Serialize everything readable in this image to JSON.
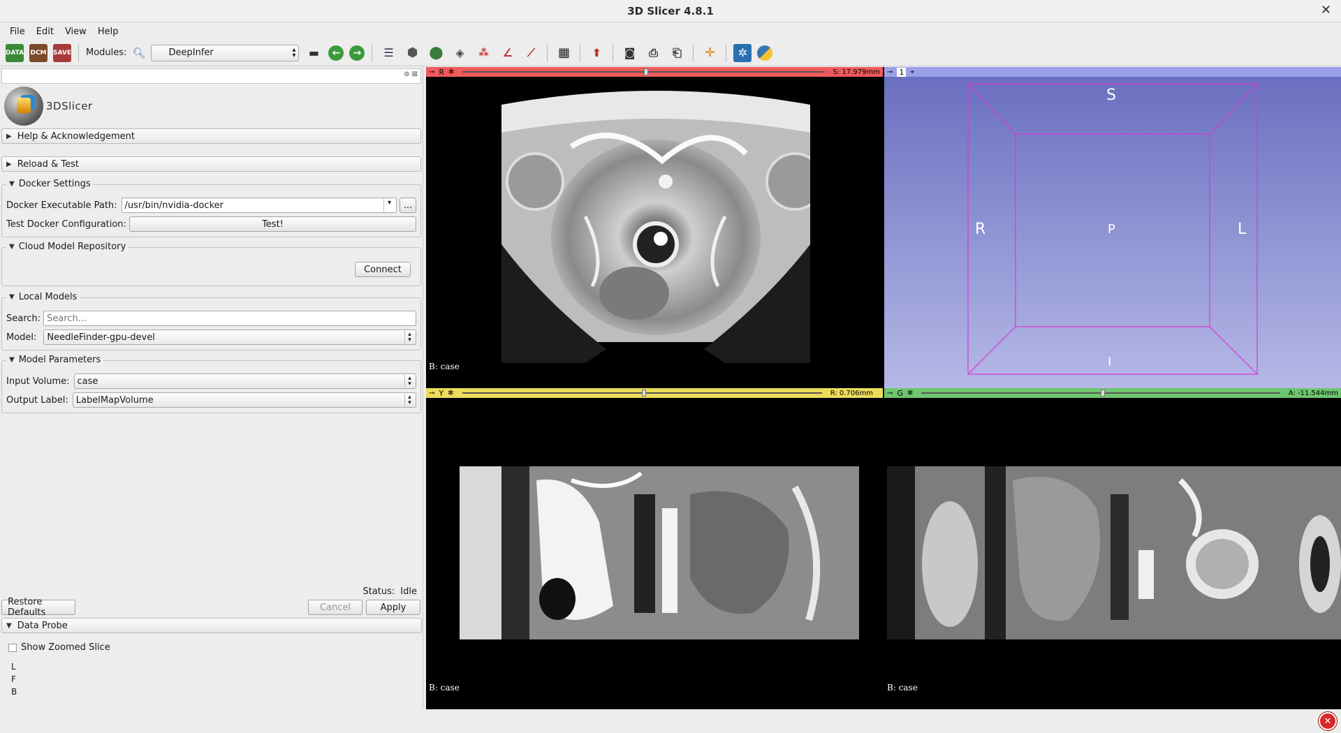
{
  "window": {
    "title": "3D Slicer 4.8.1",
    "close_glyph": "✕"
  },
  "menu": [
    "File",
    "Edit",
    "View",
    "Help"
  ],
  "toolbar": {
    "modules_label": "Modules:",
    "module_selected": "DeepInfer",
    "icons": [
      "data-icon",
      "dcm-icon",
      "save-icon",
      "modules-search-icon",
      "history-icon",
      "back-icon",
      "forward-icon",
      "data-module-icon",
      "volumes-icon",
      "models-icon",
      "transforms-icon",
      "markups-icon",
      "editor-icon",
      "segment-icon",
      "layout-icon",
      "mouse-mode-icon",
      "screenshot-icon",
      "scene-view-icon",
      "crosshair-icon",
      "extension-icon",
      "python-icon"
    ],
    "icon_labels": {
      "data": "DATA",
      "dcm": "DCM",
      "save": "SAVE"
    }
  },
  "panel": {
    "logo_text": "3DSlicer",
    "help_section": "Help & Acknowledgement",
    "reload_section": "Reload & Test",
    "docker": {
      "title": "Docker Settings",
      "exec_label": "Docker Executable Path:",
      "exec_value": "/usr/bin/nvidia-docker",
      "browse": "...",
      "test_label": "Test Docker Configuration:",
      "test_button": "Test!"
    },
    "cloud": {
      "title": "Cloud Model Repository",
      "connect": "Connect"
    },
    "local": {
      "title": "Local Models",
      "search_label": "Search:",
      "search_placeholder": "Search...",
      "model_label": "Model:",
      "model_value": "NeedleFinder-gpu-devel"
    },
    "params": {
      "title": "Model Parameters",
      "input_label": "Input Volume:",
      "input_value": "case",
      "output_label": "Output Label:",
      "output_value": "LabelMapVolume"
    },
    "status_label": "Status:",
    "status_value": "Idle",
    "restore": "Restore Defaults",
    "cancel": "Cancel",
    "apply": "Apply",
    "probe": {
      "title": "Data Probe",
      "zoom_label": "Show Zoomed Slice",
      "letters": [
        "L",
        "F",
        "B"
      ]
    }
  },
  "views": {
    "red": {
      "tag": "R",
      "offset": "S: 17.979mm",
      "caption": "B: case"
    },
    "yellow": {
      "tag": "Y",
      "offset": "R: 0.706mm",
      "caption": "B: case"
    },
    "green": {
      "tag": "G",
      "offset": "A: -11.544mm",
      "caption": "B: case"
    },
    "threed": {
      "tag": "1",
      "labels": {
        "top": "S",
        "left": "R",
        "center": "P",
        "right": "L",
        "bottom": "I"
      }
    }
  },
  "colors": {
    "red": "#f05a5a",
    "yellow": "#ecdd5a",
    "green": "#6ec66e",
    "blue": "#9aa0e8",
    "box": "#d936d9"
  }
}
